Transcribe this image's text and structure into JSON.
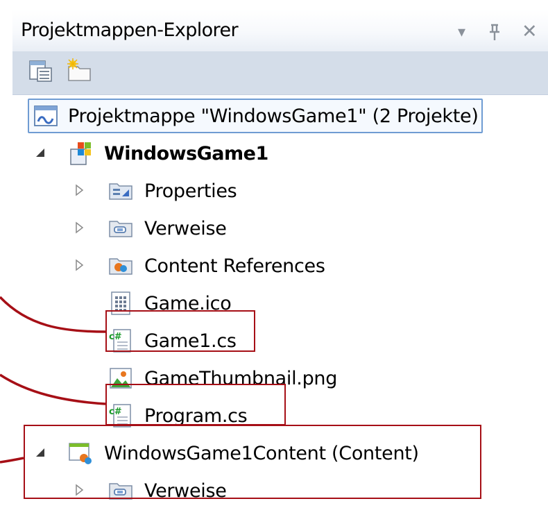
{
  "panel": {
    "title": "Projektmappen-Explorer",
    "btn_dropdown": "▾",
    "btn_pin": "ꟷ",
    "btn_close": "✕"
  },
  "toolbar": {
    "items": [
      {
        "name": "properties-tool-icon"
      },
      {
        "name": "show-all-files-icon"
      }
    ]
  },
  "tree": {
    "solution": "Projektmappe \"WindowsGame1\" (2 Projekte)",
    "project1": "WindowsGame1",
    "properties": "Properties",
    "verweise1": "Verweise",
    "content_refs": "Content References",
    "game_ico": "Game.ico",
    "game1_cs": "Game1.cs",
    "thumbnail": "GameThumbnail.png",
    "program_cs": "Program.cs",
    "project2": "WindowsGame1Content (Content)",
    "verweise2": "Verweise"
  },
  "colors": {
    "annotation": "#a60f16",
    "selection_border": "#6f9cd3",
    "toolbar_bg": "#d4dde9"
  }
}
